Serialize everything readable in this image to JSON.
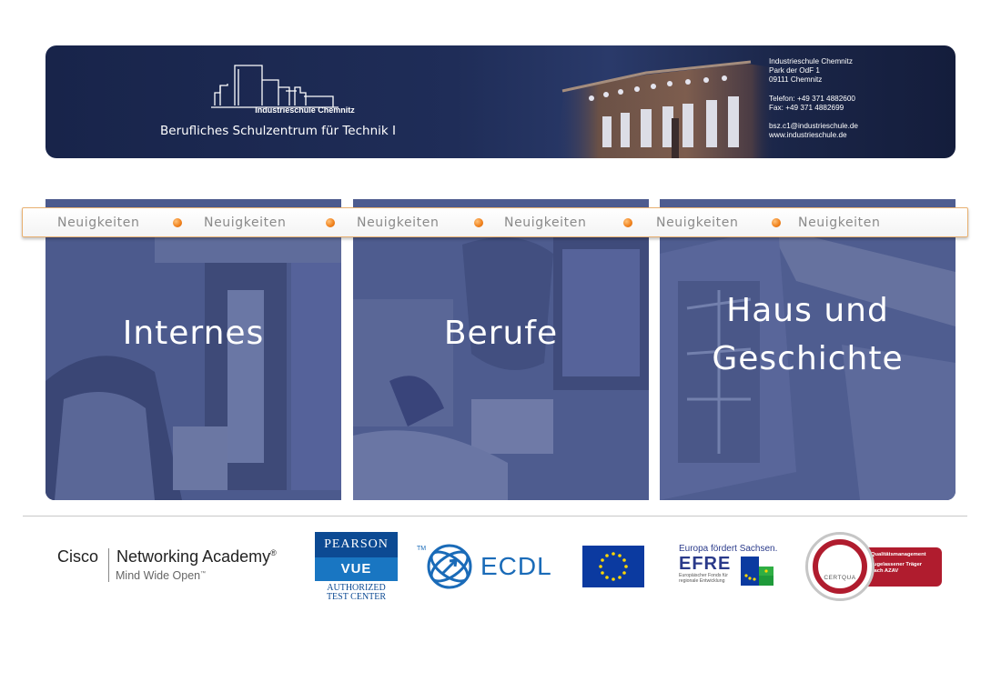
{
  "header": {
    "school_name": "Industrieschule Chemnitz",
    "subtitle": "Berufliches Schulzentrum für Technik I",
    "contact": {
      "name": "Industrieschule Chemnitz",
      "street": "Park der OdF 1",
      "city": "09111 Chemnitz",
      "phone": "Telefon: +49 371 4882600",
      "fax": "Fax: +49 371 4882699",
      "email": "bsz.c1@industrieschule.de",
      "web": "www.industrieschule.de"
    }
  },
  "ticker": {
    "items": [
      "Neuigkeiten",
      "Neuigkeiten",
      "Neuigkeiten",
      "Neuigkeiten",
      "Neuigkeiten",
      "Neuigkeiten"
    ],
    "dot_color": "#f0801a"
  },
  "tiles": [
    {
      "title_line1": "Internes",
      "title_line2": ""
    },
    {
      "title_line1": "Berufe",
      "title_line2": ""
    },
    {
      "title_line1": "Haus   und",
      "title_line2": "Geschichte"
    }
  ],
  "partners": {
    "cisco": {
      "name": "Cisco",
      "program": "Networking Academy",
      "reg": "®",
      "tagline": "Mind Wide Open",
      "tm": "™"
    },
    "pearson": {
      "top": "PEARSON",
      "mid": "VUE",
      "line1": "AUTHORIZED",
      "line2": "TEST CENTER"
    },
    "ecdl": {
      "tm": "TM",
      "text": "ECDL"
    },
    "efre": {
      "top": "Europa fördert Sachsen.",
      "big": "EFRE",
      "small1": "Europäischer Fonds für",
      "small2": "regionale Entwicklung"
    },
    "certqua": {
      "word": "CERTQUA",
      "band_top": "Qualitätsmanagement",
      "band_line1": "zugelassener Träger",
      "band_line2": "nach AZAV"
    }
  },
  "colors": {
    "header_bg": "#1f2d58",
    "tile_bg": "#4d5c8f",
    "accent_orange": "#f0801a",
    "certqua_red": "#b01c2e",
    "eu_blue": "#0b3aa0"
  }
}
